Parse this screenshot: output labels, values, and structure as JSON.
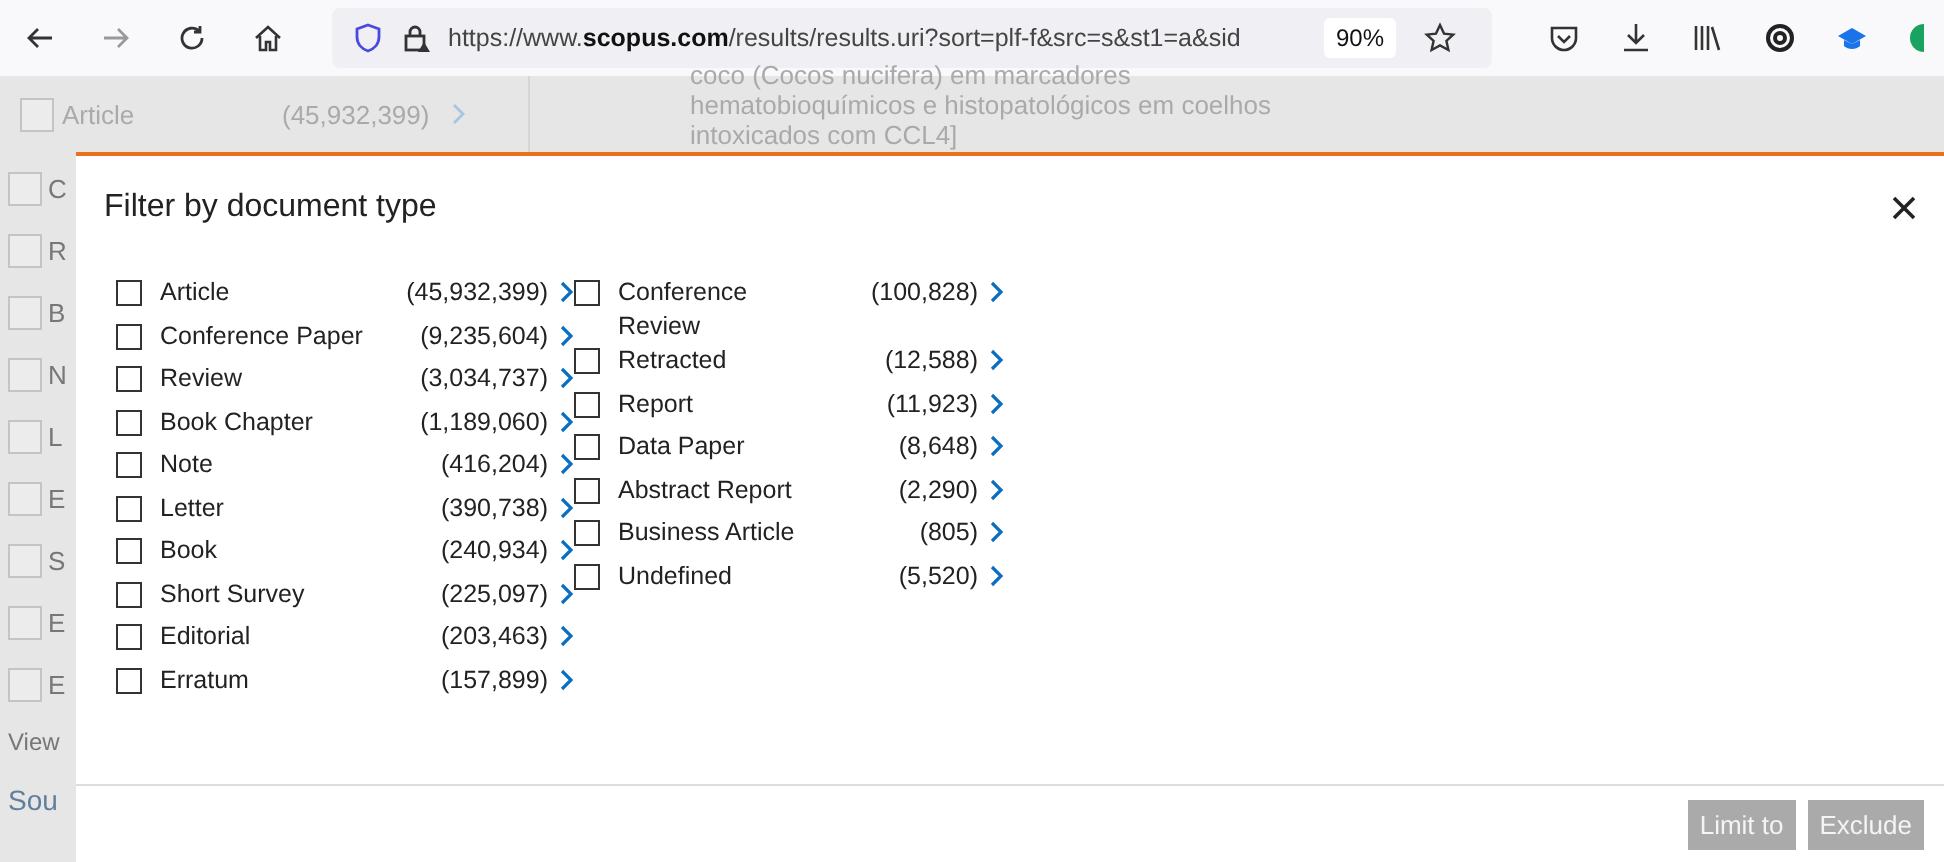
{
  "browser": {
    "url": "https://www.**scopus.com**/results/results.uri?sort=plf-f&src=s&st1=a&sid",
    "zoom": "90%"
  },
  "background": {
    "first_row": {
      "label": "Article",
      "count": "(45,932,399)",
      "checked": false
    },
    "record_title_lines": [
      "coco (Cocos nucifera) em marcadores",
      "hematobioquímicos e histopatológicos em coelhos",
      "intoxicados com CCL4]"
    ],
    "side_rows": [
      {
        "label": "C",
        "checked": false
      },
      {
        "label": "R",
        "checked": false
      },
      {
        "label": "B",
        "checked": false
      },
      {
        "label": "N",
        "checked": false
      },
      {
        "label": "L",
        "checked": false
      },
      {
        "label": "E",
        "checked": false
      },
      {
        "label": "S",
        "checked": false
      },
      {
        "label": "E",
        "checked": false
      },
      {
        "label": "E",
        "checked": false
      }
    ],
    "side_links": [
      "View",
      "Sou"
    ]
  },
  "modal": {
    "title": "Filter by document type",
    "columns": [
      [
        {
          "label": "Article",
          "count": "(45,932,399)",
          "checked": false
        },
        {
          "label": "Conference Paper",
          "count": "(9,235,604)",
          "checked": false
        },
        {
          "label": "Review",
          "count": "(3,034,737)",
          "checked": false
        },
        {
          "label": "Book Chapter",
          "count": "(1,189,060)",
          "checked": false
        },
        {
          "label": "Note",
          "count": "(416,204)",
          "checked": false
        },
        {
          "label": "Letter",
          "count": "(390,738)",
          "checked": false
        },
        {
          "label": "Book",
          "count": "(240,934)",
          "checked": false
        },
        {
          "label": "Short Survey",
          "count": "(225,097)",
          "checked": false
        },
        {
          "label": "Editorial",
          "count": "(203,463)",
          "checked": false
        },
        {
          "label": "Erratum",
          "count": "(157,899)",
          "checked": false
        }
      ],
      [
        {
          "label": "Conference Review",
          "count": "(100,828)",
          "checked": false
        },
        {
          "label": "Retracted",
          "count": "(12,588)",
          "checked": false
        },
        {
          "label": "Report",
          "count": "(11,923)",
          "checked": false
        },
        {
          "label": "Data Paper",
          "count": "(8,648)",
          "checked": false
        },
        {
          "label": "Abstract Report",
          "count": "(2,290)",
          "checked": false
        },
        {
          "label": "Business Article",
          "count": "(805)",
          "checked": false
        },
        {
          "label": "Undefined",
          "count": "(5,520)",
          "checked": false
        }
      ]
    ],
    "buttons": [
      {
        "label": "Limit to",
        "disabled": true
      },
      {
        "label": "Exclude",
        "disabled": true
      }
    ]
  }
}
